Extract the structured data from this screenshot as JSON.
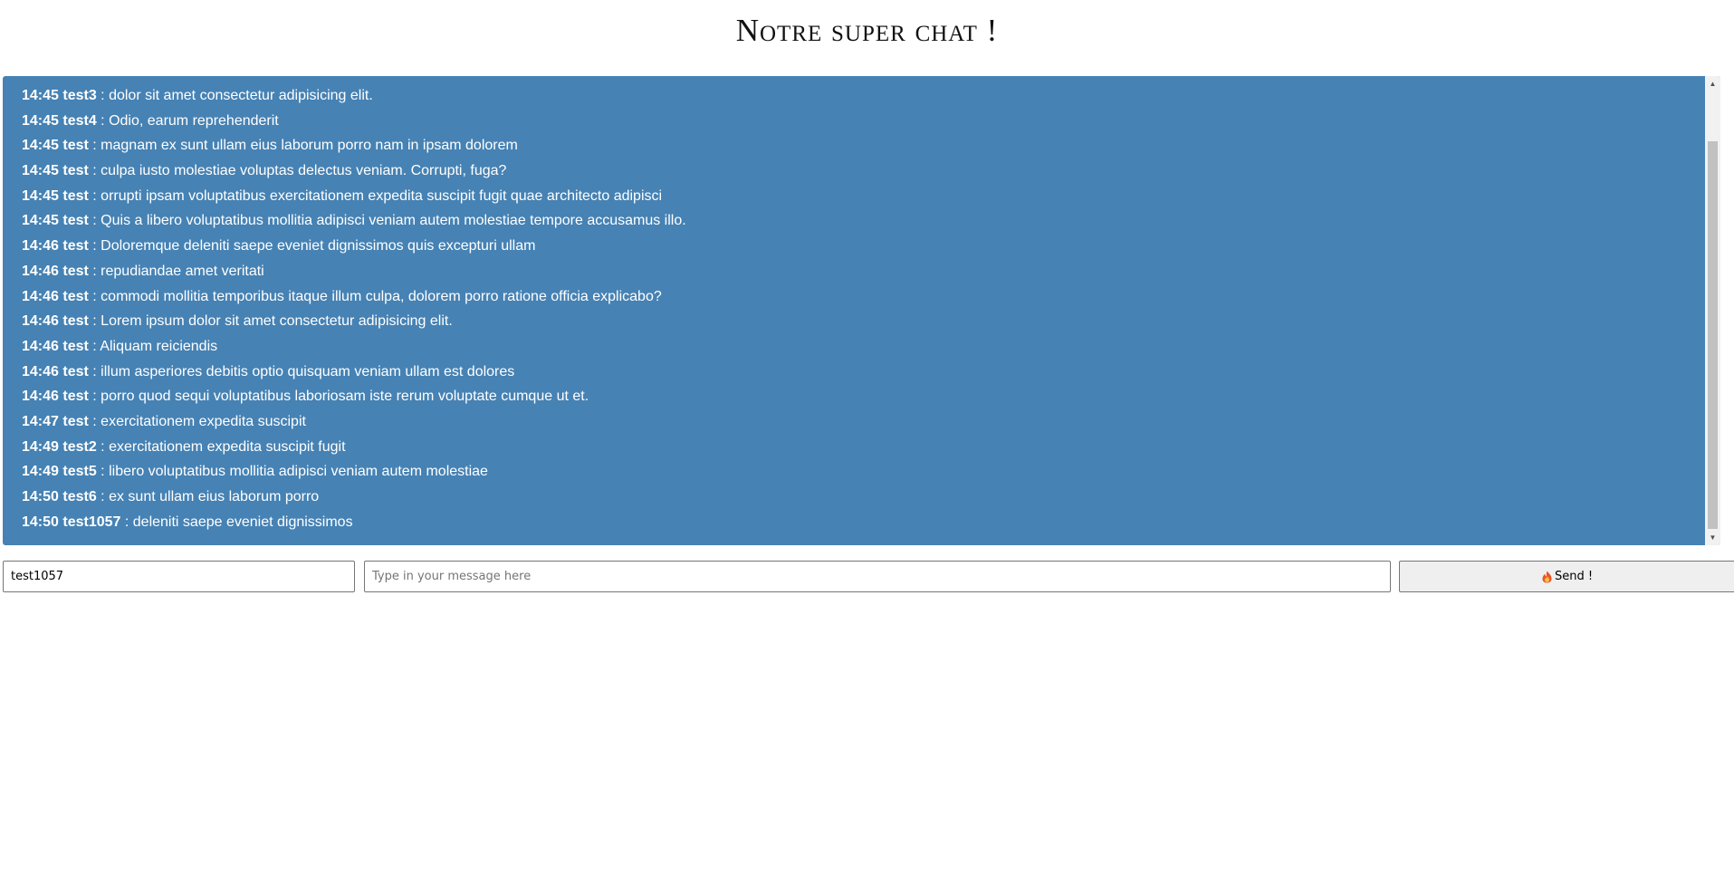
{
  "header": {
    "title": "Notre super chat !"
  },
  "messages": [
    {
      "time": "14:45",
      "user": "test3",
      "text": "dolor sit amet consectetur adipisicing elit."
    },
    {
      "time": "14:45",
      "user": "test4",
      "text": "Odio, earum reprehenderit"
    },
    {
      "time": "14:45",
      "user": "test",
      "text": "magnam ex sunt ullam eius laborum porro nam in ipsam dolorem"
    },
    {
      "time": "14:45",
      "user": "test",
      "text": "culpa iusto molestiae voluptas delectus veniam. Corrupti, fuga?"
    },
    {
      "time": "14:45",
      "user": "test",
      "text": "orrupti ipsam voluptatibus exercitationem expedita suscipit fugit quae architecto adipisci"
    },
    {
      "time": "14:45",
      "user": "test",
      "text": "Quis a libero voluptatibus mollitia adipisci veniam autem molestiae tempore accusamus illo."
    },
    {
      "time": "14:46",
      "user": "test",
      "text": "Doloremque deleniti saepe eveniet dignissimos quis excepturi ullam"
    },
    {
      "time": "14:46",
      "user": "test",
      "text": "repudiandae amet veritati"
    },
    {
      "time": "14:46",
      "user": "test",
      "text": "commodi mollitia temporibus itaque illum culpa, dolorem porro ratione officia explicabo?"
    },
    {
      "time": "14:46",
      "user": "test",
      "text": "Lorem ipsum dolor sit amet consectetur adipisicing elit."
    },
    {
      "time": "14:46",
      "user": "test",
      "text": "Aliquam reiciendis"
    },
    {
      "time": "14:46",
      "user": "test",
      "text": "illum asperiores debitis optio quisquam veniam ullam est dolores"
    },
    {
      "time": "14:46",
      "user": "test",
      "text": "porro quod sequi voluptatibus laboriosam iste rerum voluptate cumque ut et."
    },
    {
      "time": "14:47",
      "user": "test",
      "text": "exercitationem expedita suscipit"
    },
    {
      "time": "14:49",
      "user": "test2",
      "text": "exercitationem expedita suscipit fugit"
    },
    {
      "time": "14:49",
      "user": "test5",
      "text": "libero voluptatibus mollitia adipisci veniam autem molestiae"
    },
    {
      "time": "14:50",
      "user": "test6",
      "text": "ex sunt ullam eius laborum porro"
    },
    {
      "time": "14:50",
      "user": "test1057",
      "text": "deleniti saepe eveniet dignissimos"
    }
  ],
  "form": {
    "pseudo_value": "test1057",
    "message_placeholder": "Type in your message here",
    "send_label": "Send !",
    "send_icon": "fire-icon"
  },
  "colors": {
    "chat_background": "#4682b4",
    "message_text": "#ffffff"
  }
}
